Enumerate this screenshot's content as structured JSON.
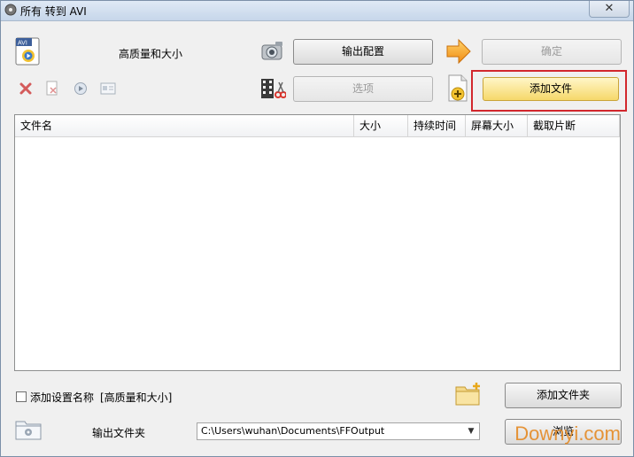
{
  "window": {
    "title": "所有 转到 AVI"
  },
  "profile": {
    "label": "高质量和大小"
  },
  "toolbar": {
    "output_config": "输出配置",
    "confirm": "确定",
    "options": "选项",
    "add_file": "添加文件"
  },
  "file_list": {
    "columns": [
      "文件名",
      "大小",
      "持续时间",
      "屏幕大小",
      "截取片断"
    ],
    "rows": []
  },
  "bottom": {
    "append_setting_label": "添加设置名称",
    "append_setting_value": "[高质量和大小]",
    "append_setting_checked": false,
    "add_folder": "添加文件夹",
    "output_folder_label": "输出文件夹",
    "output_folder_path": "C:\\Users\\wuhan\\Documents\\FFOutput",
    "browse": "浏览"
  },
  "watermark": "Downyi.com",
  "icons": {
    "avi_file": "avi-file-icon",
    "remove": "remove-icon",
    "clear": "clear-list-icon",
    "play": "play-icon",
    "info": "info-icon",
    "output_config": "camera-settings-icon",
    "arrow": "arrow-right-icon",
    "options": "film-scissors-icon",
    "add_file": "add-file-icon",
    "folder_add": "folder-add-icon",
    "folder": "folder-icon"
  }
}
